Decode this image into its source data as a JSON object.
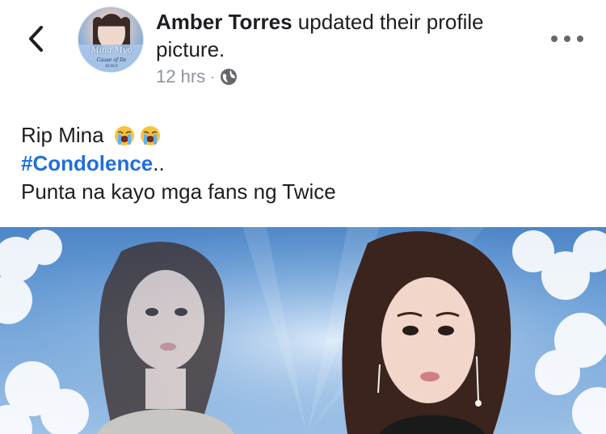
{
  "header": {
    "back_icon": "chevron-left-icon",
    "author": "Amber Torres",
    "action": " updated their profile picture.",
    "time": "12 hrs",
    "separator": "·",
    "privacy_icon": "globe-icon",
    "more_icon": "more-horizontal-icon",
    "avatar_text": {
      "line1": "Mina Myo",
      "line2": "Cause of De",
      "line3": "SUICI"
    }
  },
  "post": {
    "line1_text": "Rip Mina",
    "line1_emojis": [
      "loudly-crying-face-emoji",
      "loudly-crying-face-emoji"
    ],
    "hashtag": "#Condolence",
    "hashtag_suffix": "..",
    "line3_text": "Punta na kayo mga fans ng Twice"
  },
  "photo": {
    "description_icon": "photo-image"
  },
  "colors": {
    "text": "#1c1e21",
    "secondary": "#8d949e",
    "link": "#216fdb",
    "sky": "#6fa2d8"
  }
}
